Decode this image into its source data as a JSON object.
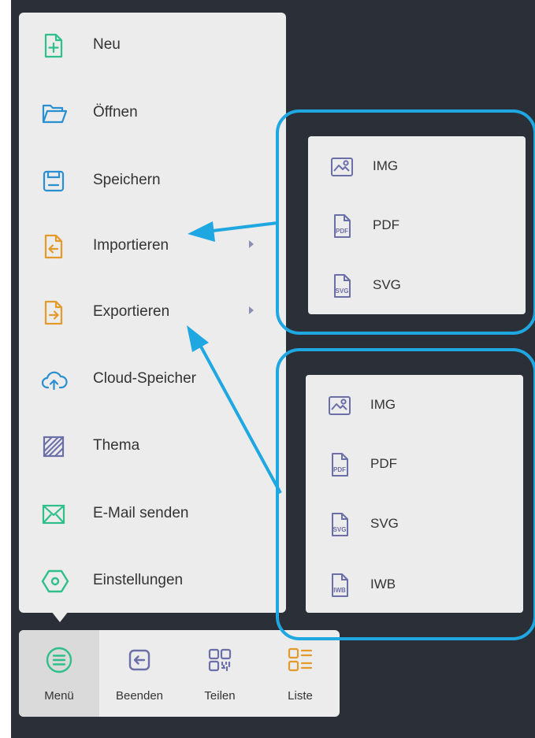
{
  "menu": {
    "items": [
      {
        "label": "Neu",
        "icon": "new-file-icon"
      },
      {
        "label": "Öffnen",
        "icon": "folder-open-icon"
      },
      {
        "label": "Speichern",
        "icon": "save-icon"
      },
      {
        "label": "Importieren",
        "icon": "import-icon",
        "has_submenu": true
      },
      {
        "label": "Exportieren",
        "icon": "export-icon",
        "has_submenu": true
      },
      {
        "label": "Cloud-Speicher",
        "icon": "cloud-icon"
      },
      {
        "label": "Thema",
        "icon": "theme-icon"
      },
      {
        "label": "E-Mail senden",
        "icon": "mail-icon"
      },
      {
        "label": "Einstellungen",
        "icon": "settings-icon"
      }
    ]
  },
  "toolbar": {
    "items": [
      {
        "label": "Menü",
        "icon": "menu-icon",
        "active": true
      },
      {
        "label": "Beenden",
        "icon": "exit-icon"
      },
      {
        "label": "Teilen",
        "icon": "qr-share-icon"
      },
      {
        "label": "Liste",
        "icon": "list-icon"
      }
    ]
  },
  "import_submenu": {
    "items": [
      {
        "label": "IMG",
        "icon": "image-file-icon"
      },
      {
        "label": "PDF",
        "icon": "pdf-file-icon",
        "badge": "PDF"
      },
      {
        "label": "SVG",
        "icon": "svg-file-icon",
        "badge": "SVG"
      }
    ]
  },
  "export_submenu": {
    "items": [
      {
        "label": "IMG",
        "icon": "image-file-icon"
      },
      {
        "label": "PDF",
        "icon": "pdf-file-icon",
        "badge": "PDF"
      },
      {
        "label": "SVG",
        "icon": "svg-file-icon",
        "badge": "SVG"
      },
      {
        "label": "IWB",
        "icon": "iwb-file-icon",
        "badge": "IWB"
      }
    ]
  },
  "colors": {
    "background": "#2b2f38",
    "panel": "#ececec",
    "callout": "#1fa7e1",
    "green": "#2fbf8a",
    "blue": "#2a8fd0",
    "orange": "#e39a2b",
    "purple": "#6b6fa8"
  }
}
